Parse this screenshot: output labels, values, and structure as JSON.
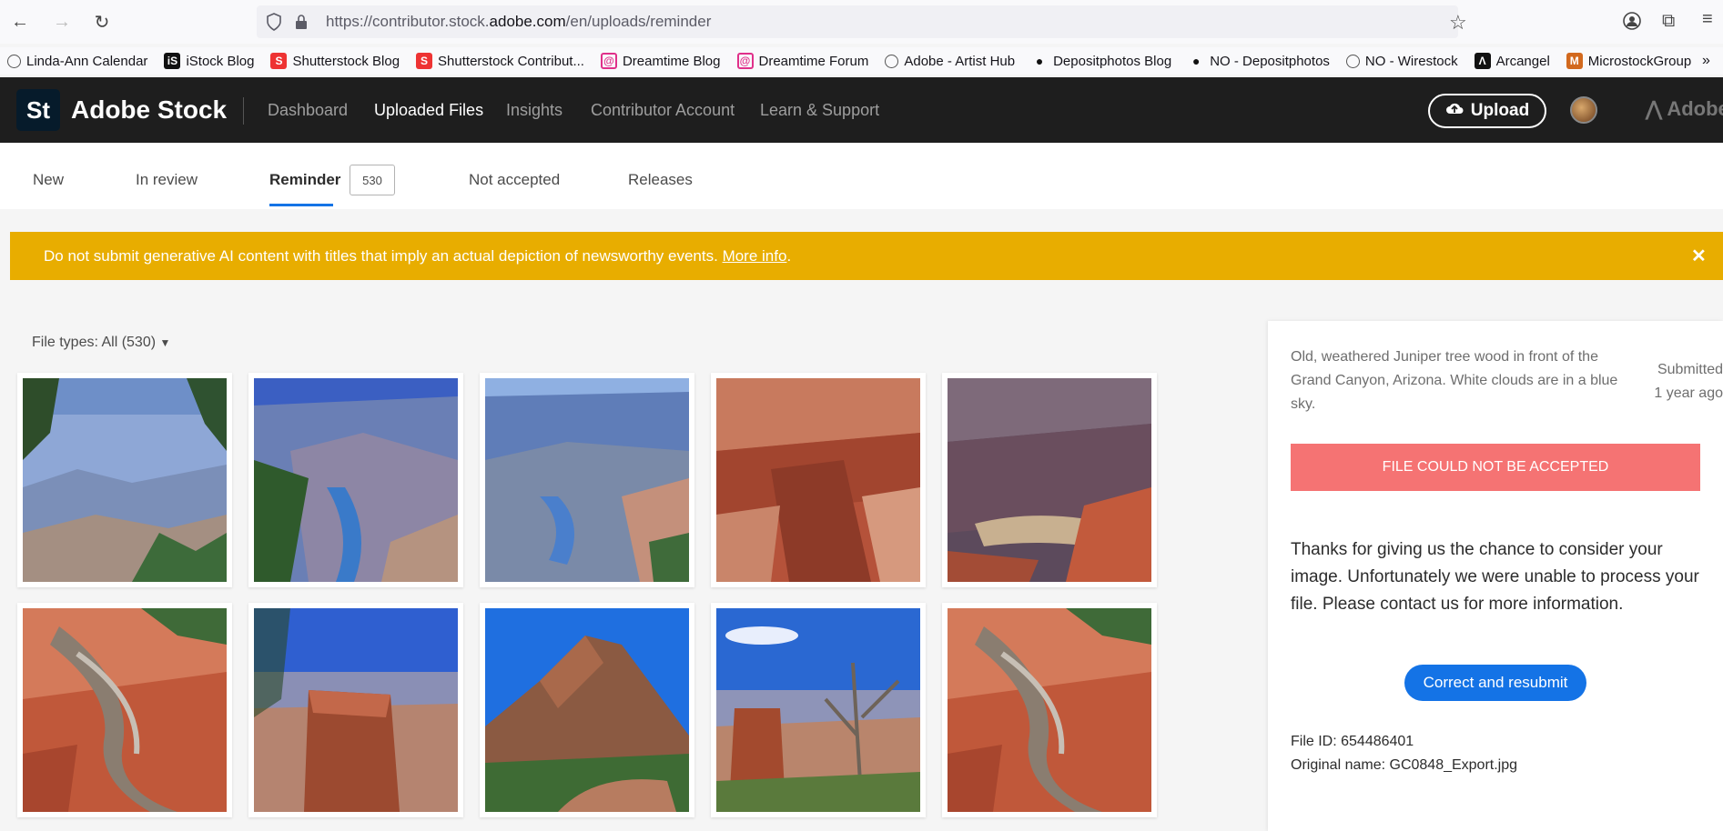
{
  "browser": {
    "url_prefix": "https://contributor.stock.",
    "url_domain": "adobe.com",
    "url_path": "/en/uploads/reminder",
    "bookmarks": [
      {
        "label": "Linda-Ann Calendar",
        "icon": "globe-icon"
      },
      {
        "label": "iStock Blog",
        "icon": "istock-icon"
      },
      {
        "label": "Shutterstock Blog",
        "icon": "shutterstock-icon"
      },
      {
        "label": "Shutterstock Contribut...",
        "icon": "shutterstock-icon"
      },
      {
        "label": "Dreamtime Blog",
        "icon": "dreamstime-icon"
      },
      {
        "label": "Dreamtime Forum",
        "icon": "dreamstime-icon"
      },
      {
        "label": "Adobe - Artist Hub",
        "icon": "globe-icon"
      },
      {
        "label": "Depositphotos Blog",
        "icon": "depositphotos-icon"
      },
      {
        "label": "NO - Depositphotos",
        "icon": "depositphotos-icon"
      },
      {
        "label": "NO - Wirestock",
        "icon": "globe-icon"
      },
      {
        "label": "Arcangel",
        "icon": "arcangel-icon"
      },
      {
        "label": "MicrostockGroup",
        "icon": "microstock-icon"
      }
    ]
  },
  "header": {
    "logo": "St",
    "brand": "Adobe Stock",
    "nav": [
      "Dashboard",
      "Uploaded Files",
      "Insights",
      "Contributor Account",
      "Learn & Support"
    ],
    "active_nav": "Uploaded Files",
    "upload_label": "Upload",
    "adobe_label": "Adobe"
  },
  "tabs": {
    "items": [
      "New",
      "In review",
      "Reminder",
      "Not accepted",
      "Releases"
    ],
    "active": "Reminder",
    "reminder_count": "530"
  },
  "banner": {
    "text": "Do not submit generative AI content with titles that imply an actual depiction of newsworthy events. ",
    "link": "More info",
    "suffix": "."
  },
  "filter": {
    "label": "File types: All (530)"
  },
  "panel": {
    "title": "Old, weathered Juniper tree wood in front of the Grand Canyon, Arizona. White clouds are in a blue sky.",
    "submitted": "Submitted",
    "submitted_time": "1 year ago",
    "status": "FILE COULD NOT BE ACCEPTED",
    "message": "Thanks for giving us the chance to consider your image. Unfortunately we were unable to process your file. Please contact us for more information.",
    "resubmit_label": "Correct and resubmit",
    "file_id": "File ID: 654486401",
    "original_name": "Original name: GC0848_Export.jpg"
  },
  "colors": {
    "header_bg": "#1e1e1e",
    "banner_bg": "#e8ad00",
    "accent": "#1473e6",
    "reject": "#f57373"
  }
}
